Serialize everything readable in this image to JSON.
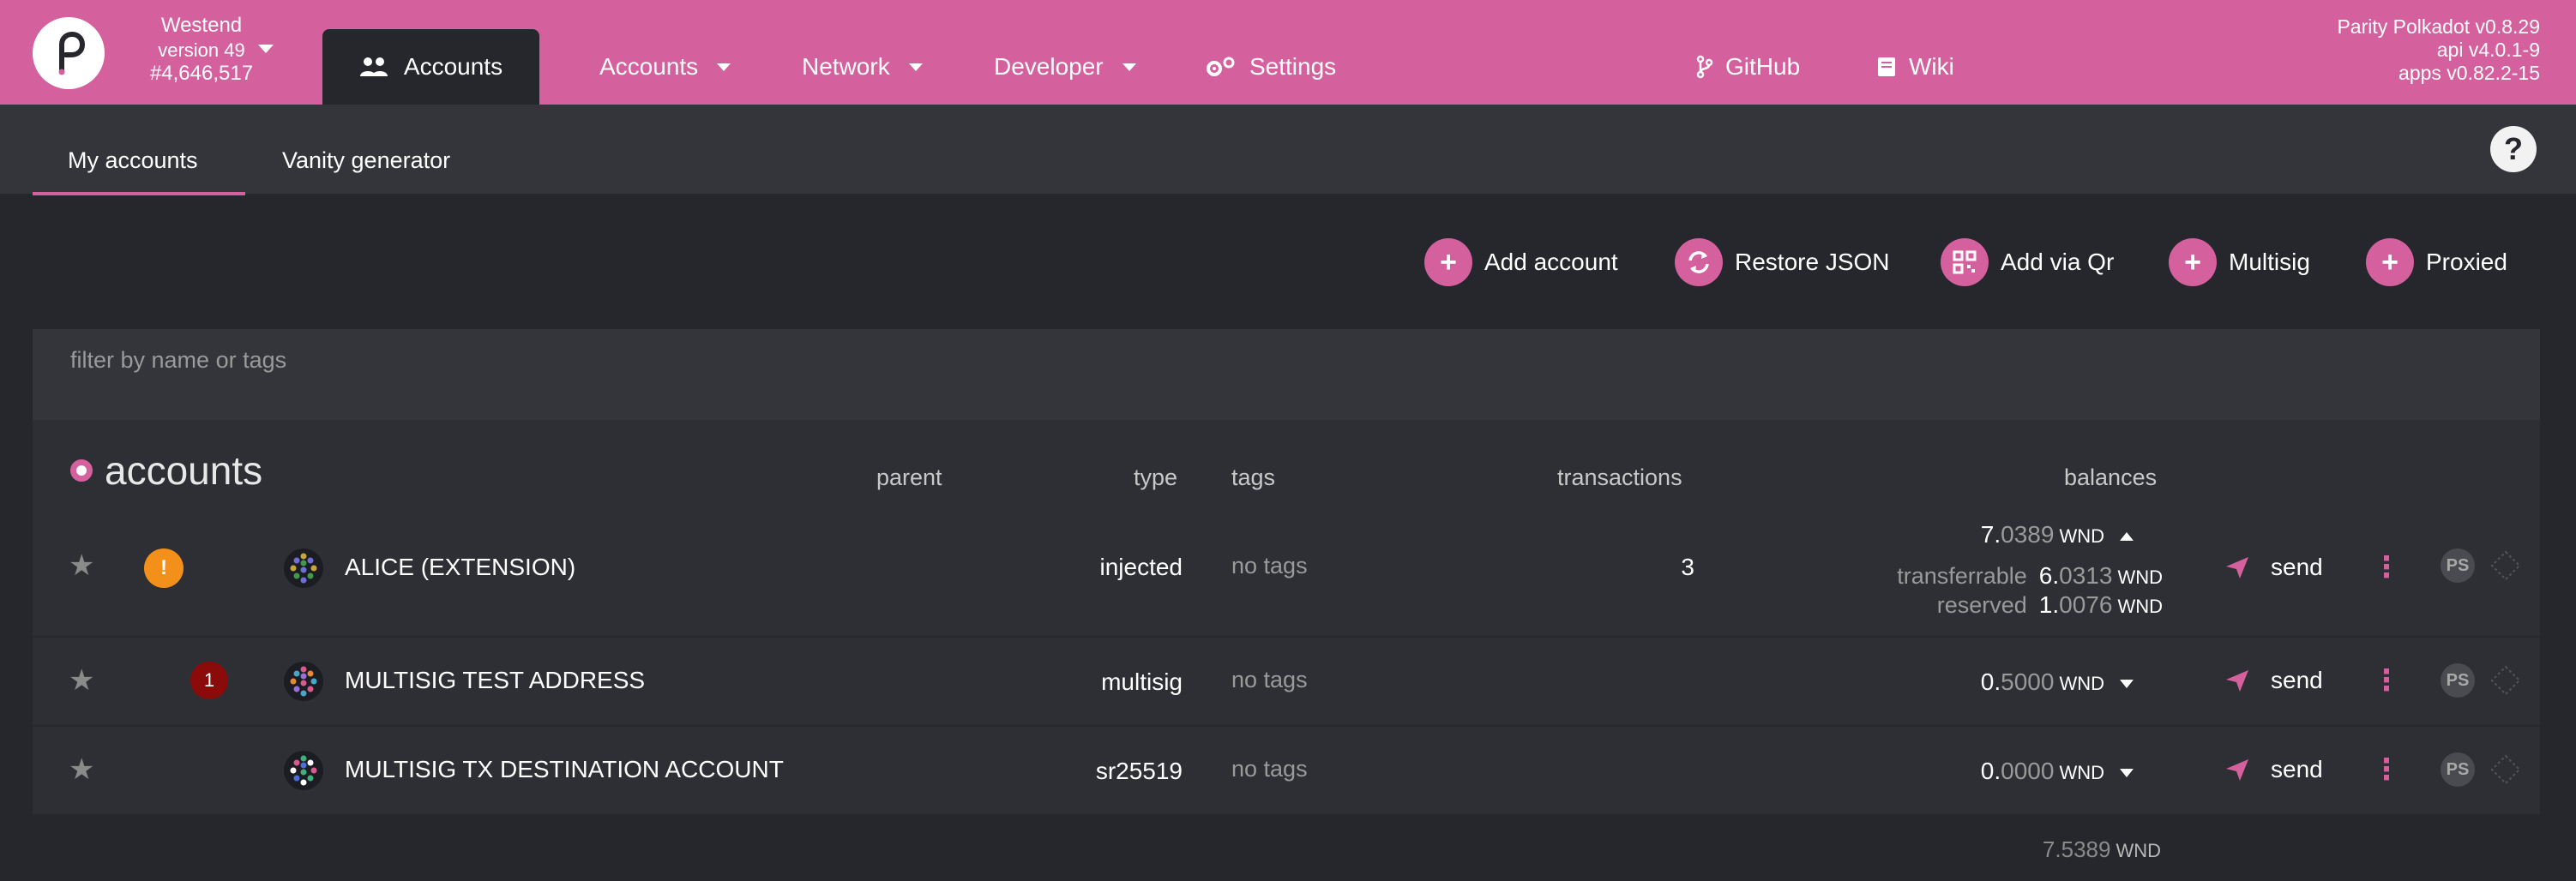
{
  "header": {
    "chain": {
      "name": "Westend",
      "version": "version 49",
      "block": "#4,646,517"
    },
    "active_tab": {
      "label": "Accounts",
      "icon": "users-icon"
    },
    "nav": [
      {
        "label": "Accounts",
        "has_dropdown": true
      },
      {
        "label": "Network",
        "has_dropdown": true
      },
      {
        "label": "Developer",
        "has_dropdown": true
      },
      {
        "label": "Settings",
        "icon": "gear-icon"
      },
      {
        "label": "GitHub",
        "icon": "git-branch-icon"
      },
      {
        "label": "Wiki",
        "icon": "book-icon"
      }
    ],
    "versions": [
      "Parity Polkadot v0.8.29",
      "api v4.0.1-9",
      "apps v0.82.2-15"
    ]
  },
  "subtabs": {
    "my_accounts": "My accounts",
    "vanity": "Vanity generator",
    "active": "My accounts"
  },
  "actions": [
    {
      "label": "Add account",
      "icon": "plus-icon"
    },
    {
      "label": "Restore JSON",
      "icon": "sync-icon"
    },
    {
      "label": "Add via Qr",
      "icon": "qrcode-icon"
    },
    {
      "label": "Multisig",
      "icon": "plus-icon"
    },
    {
      "label": "Proxied",
      "icon": "plus-icon"
    }
  ],
  "filter": {
    "placeholder": "filter by name or tags",
    "value": ""
  },
  "table": {
    "title": "accounts",
    "columns": {
      "parent": "parent",
      "type": "type",
      "tags": "tags",
      "transactions": "transactions",
      "balances": "balances"
    },
    "rows": [
      {
        "name": "ALICE (EXTENSION)",
        "type": "injected",
        "tags": "no tags",
        "transactions": "3",
        "badge": "warning",
        "balance": {
          "int": "7.",
          "dec": "0389",
          "unit": "WND"
        },
        "expanded": true,
        "transferrable": {
          "label": "transferrable",
          "int": "6.",
          "dec": "0313",
          "unit": "WND"
        },
        "reserved": {
          "label": "reserved",
          "int": "1.",
          "dec": "0076",
          "unit": "WND"
        },
        "send_label": "send"
      },
      {
        "name": "MULTISIG TEST ADDRESS",
        "type": "multisig",
        "tags": "no tags",
        "transactions": "",
        "badge": "1",
        "balance": {
          "int": "0.",
          "dec": "5000",
          "unit": "WND"
        },
        "expanded": false,
        "send_label": "send"
      },
      {
        "name": "MULTISIG TX DESTINATION ACCOUNT",
        "type": "sr25519",
        "tags": "no tags",
        "transactions": "",
        "badge": "",
        "balance": {
          "int": "0.",
          "dec": "0000",
          "unit": "WND"
        },
        "expanded": false,
        "send_label": "send"
      }
    ],
    "total": {
      "int": "7.",
      "dec": "5389",
      "unit": "WND"
    }
  },
  "ps_label": "PS",
  "help_label": "?",
  "colors": {
    "accent": "#d4609e",
    "background": "#26272c",
    "panel": "#34353a",
    "warning": "#f39019",
    "badge": "#8b0a0a"
  }
}
